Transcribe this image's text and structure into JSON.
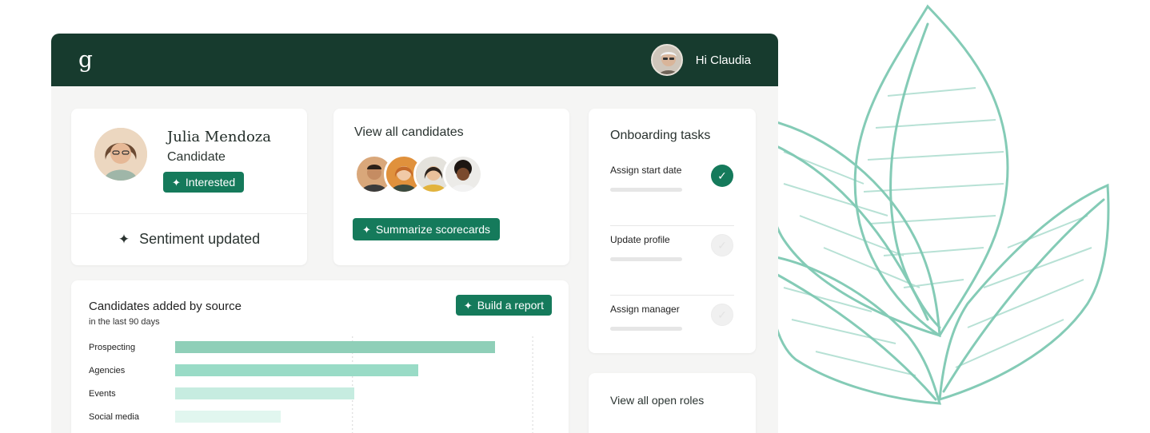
{
  "topbar": {
    "logo": "g",
    "greeting": "Hi Claudia"
  },
  "profile": {
    "name": "Julia Mendoza",
    "role": "Candidate",
    "badge": "Interested",
    "footer": "Sentiment updated"
  },
  "candidates": {
    "title": "View all candidates",
    "button": "Summarize scorecards"
  },
  "onboarding": {
    "title": "Onboarding tasks",
    "tasks": [
      {
        "label": "Assign start date",
        "done": true
      },
      {
        "label": "Update profile",
        "done": false
      },
      {
        "label": "Assign manager",
        "done": false
      }
    ]
  },
  "roles": {
    "title": "View all open roles"
  },
  "report": {
    "title": "Candidates added by source",
    "subtitle": "in the last 90 days",
    "button": "Build a report"
  },
  "chart_data": {
    "type": "bar",
    "orientation": "horizontal",
    "title": "Candidates added by source",
    "subtitle": "in the last 90 days",
    "categories": [
      "Prospecting",
      "Agencies",
      "Events",
      "Social media"
    ],
    "values": [
      100,
      76,
      56,
      33
    ],
    "xlim": [
      0,
      112
    ],
    "colors": [
      "#8fcfb8",
      "#99dbc6",
      "#c6ece0",
      "#e1f6ef"
    ],
    "grid": "vertical dashed"
  }
}
